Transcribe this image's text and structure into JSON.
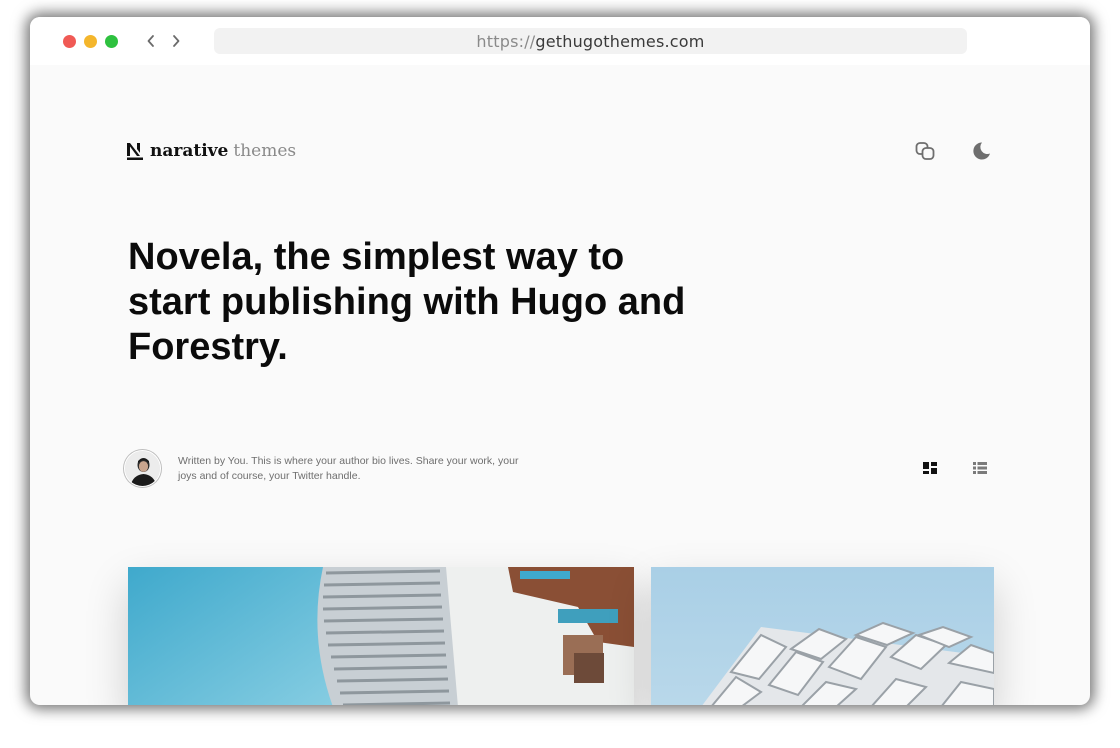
{
  "browser": {
    "url_protocol": "https://",
    "url_domain": "gethugothemes.com"
  },
  "header": {
    "logo_primary": "narative",
    "logo_secondary": "themes"
  },
  "hero": {
    "title": "Novela, the simplest way to start publishing with Hugo and Forestry."
  },
  "author": {
    "bio": "Written by You. This is where your author bio lives. Share your work, your joys and of course, your Twitter handle."
  },
  "icons": {
    "copy": "copy-link-icon",
    "theme": "moon-icon",
    "grid": "grid-layout-icon",
    "list": "list-layout-icon"
  },
  "colors": {
    "close": "#f05a55",
    "minimize": "#f4b62c",
    "maximize": "#2ec13f",
    "page_bg": "#fafafa",
    "sky_left": "#5bb8d6",
    "sky_right": "#a9cfe6"
  }
}
